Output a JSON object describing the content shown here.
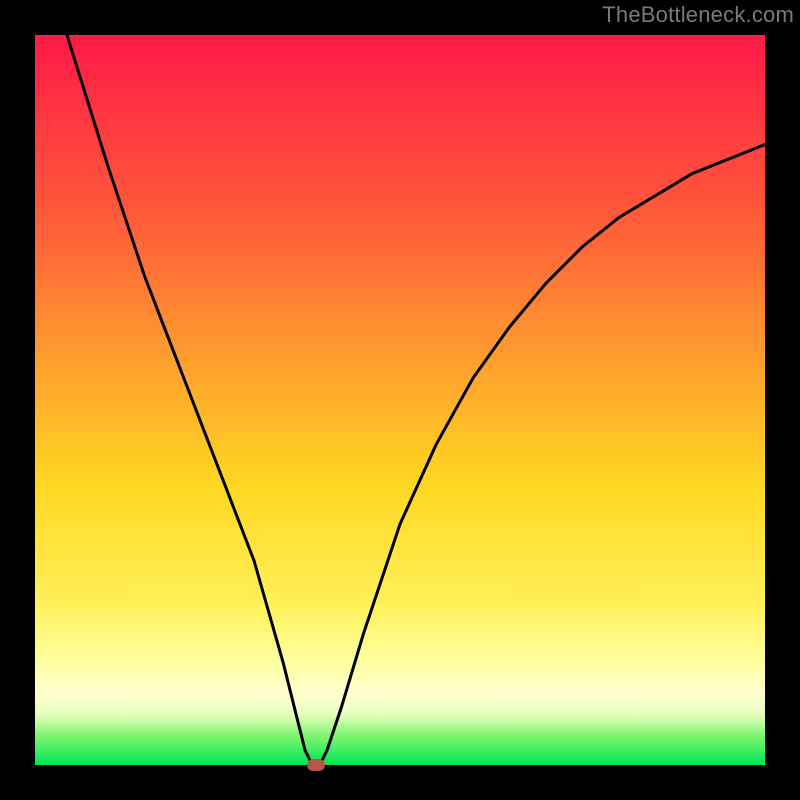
{
  "watermark": "TheBottleneck.com",
  "chart_data": {
    "type": "line",
    "title": "",
    "xlabel": "",
    "ylabel": "",
    "xlim": [
      0,
      100
    ],
    "ylim": [
      0,
      100
    ],
    "legend": false,
    "grid": false,
    "background_gradient": [
      "#ff1a47",
      "#ff5a3a",
      "#ffa02e",
      "#ffd822",
      "#fff05a",
      "#ffffd0",
      "#00e655"
    ],
    "series": [
      {
        "name": "bottleneck-curve",
        "x": [
          0,
          2,
          5,
          10,
          15,
          20,
          25,
          30,
          34,
          36,
          37,
          38,
          39,
          40,
          42,
          45,
          50,
          55,
          60,
          65,
          70,
          75,
          80,
          85,
          90,
          95,
          100
        ],
        "y": [
          115,
          108,
          98,
          82,
          67,
          54,
          41,
          28,
          14,
          6,
          2,
          0,
          0,
          2,
          8,
          18,
          33,
          44,
          53,
          60,
          66,
          71,
          75,
          78,
          81,
          83,
          85
        ]
      }
    ],
    "marker": {
      "name": "optimal-point",
      "x": 38.5,
      "y": 0,
      "color": "#b8564a"
    }
  }
}
